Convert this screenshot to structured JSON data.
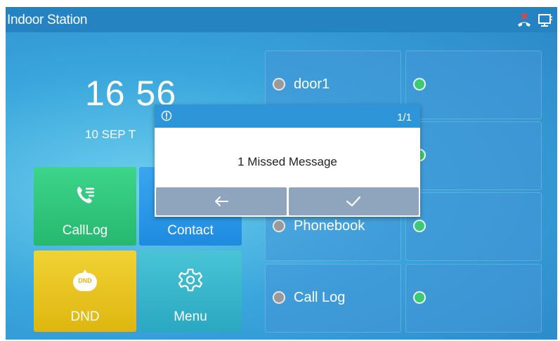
{
  "titlebar": {
    "title": "Indoor Station",
    "icons": [
      "missed-call-icon",
      "network-icon"
    ]
  },
  "clock": {
    "time": "16 56",
    "date": "10 SEP T"
  },
  "tiles": [
    {
      "label": "CallLog",
      "icon": "phone-list-icon",
      "color": "#2fc57d"
    },
    {
      "label": "Contact",
      "icon": "contact-icon",
      "color": "#2a96e8"
    },
    {
      "label": "DND",
      "icon": "dnd-icon",
      "color": "#e9c421",
      "badge": "DND"
    },
    {
      "label": "Menu",
      "icon": "gear-icon",
      "color": "#36b6cc"
    }
  ],
  "grid": [
    {
      "label": "door1",
      "dot": "grey"
    },
    {
      "label": "",
      "dot": "green"
    },
    {
      "label": "",
      "dot": "green"
    },
    {
      "label": "Phonebook",
      "dot": "grey"
    },
    {
      "label": "",
      "dot": "green"
    },
    {
      "label": "Call Log",
      "dot": "grey"
    },
    {
      "label": "",
      "dot": "green"
    }
  ],
  "dialog": {
    "page": "1/1",
    "message": "1 Missed Message",
    "back_icon": "back-arrow-icon",
    "confirm_icon": "check-icon"
  },
  "colors": {
    "titlebar": "#2683c2",
    "dialog_header": "#2f95d9",
    "dialog_button": "#8fa4bd"
  }
}
